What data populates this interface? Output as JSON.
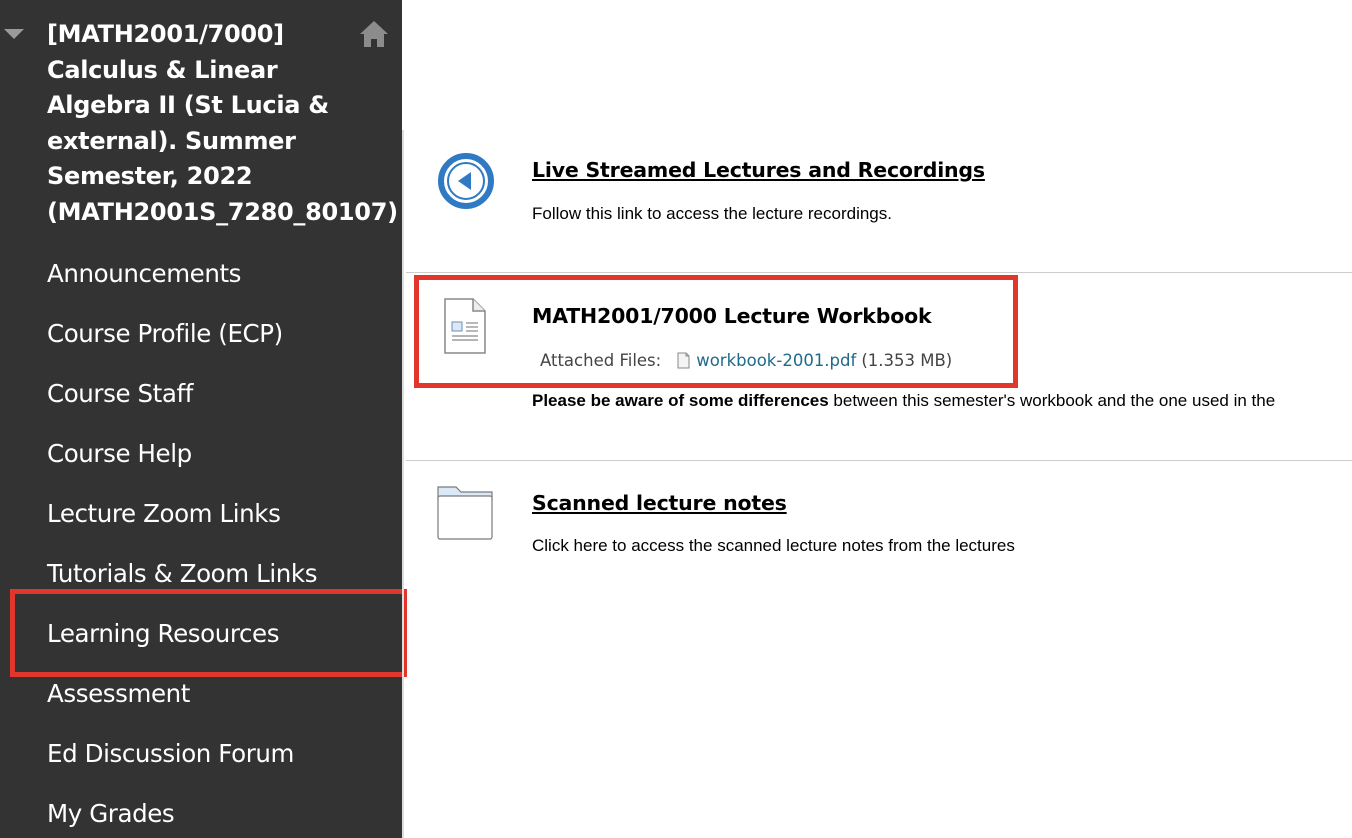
{
  "sidebar": {
    "course_title": "[MATH2001/7000] Calculus & Linear Algebra II (St Lucia & external). Summer Semester, 2022 (MATH2001S_7280_80107)",
    "items": [
      {
        "label": "Announcements"
      },
      {
        "label": "Course Profile (ECP)"
      },
      {
        "label": "Course Staff"
      },
      {
        "label": "Course Help"
      },
      {
        "label": "Lecture Zoom Links"
      },
      {
        "label": "Tutorials & Zoom Links"
      },
      {
        "label": "Learning Resources"
      },
      {
        "label": "Assessment"
      },
      {
        "label": "Ed Discussion Forum"
      },
      {
        "label": "My Grades"
      }
    ],
    "icons": {
      "collapse": "triangle-down-icon",
      "home": "home-icon"
    }
  },
  "content": {
    "items": [
      {
        "title": "Live Streamed Lectures and Recordings",
        "description": "Follow this link to access the lecture recordings.",
        "icon": "link-arrow-icon"
      },
      {
        "title": "MATH2001/7000 Lecture Workbook",
        "attached_label": "Attached Files:",
        "file_name": "workbook-2001.pdf",
        "file_size": "(1.353 MB)",
        "note_bold": "Please be aware of some differences",
        "note_rest": " between this semester's workbook and the one used in the",
        "icon": "document-icon"
      },
      {
        "title": "Scanned lecture notes",
        "description": "Click here to access the scanned lecture notes from the lectures",
        "icon": "folder-icon"
      }
    ]
  },
  "colors": {
    "sidebar_bg": "#333333",
    "highlight": "#e0362b",
    "link_blue": "#1e6a8c",
    "icon_blue": "#2f7ac2"
  }
}
